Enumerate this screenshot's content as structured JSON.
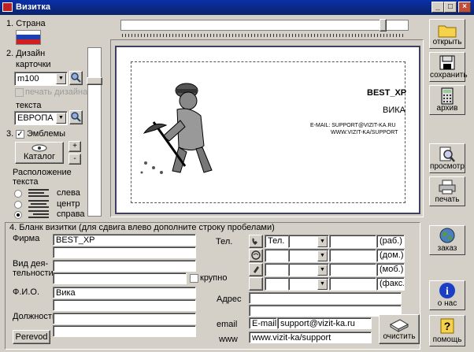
{
  "window": {
    "title": "Визитка"
  },
  "left": {
    "country_label": "1. Страна",
    "design_label_1": "2. Дизайн",
    "design_label_2": "карточки",
    "design_value": "m100",
    "design_check_label": "печать дизайна",
    "text_label": "текста",
    "text_value": "ЕВРОПА",
    "emblems_label": "3.",
    "emblems_check_label": "Эмблемы",
    "catalog_button": "Каталог",
    "plus": "+",
    "minus": "-",
    "placement_label_1": "Расположение",
    "placement_label_2": "текста",
    "placement_options": [
      "слева",
      "центр",
      "справа"
    ],
    "placement_selected": 2
  },
  "card": {
    "company": "BEST_XP",
    "name": "ВИКА",
    "email_line": "E-MAIL: SUPPORT@VIZIT-KA.RU",
    "www_line": "WWW.VIZIT-KA/SUPPORT"
  },
  "form": {
    "heading": "4. Бланк визитки (для сдвига влево дополните строку пробелами)",
    "firm_label": "Фирма",
    "firm_value": "BEST_XP",
    "activity_label_1": "Вид дея-",
    "activity_label_2": "тельности",
    "bold_label": "крупно",
    "fio_label": "Ф.И.О.",
    "fio_value": "Вика",
    "position_label": "Должность",
    "perevod_button": "Perevod",
    "phone_label": "Тел.",
    "phone_rows": [
      {
        "prefix": "Тел.",
        "suffix": "(раб.)"
      },
      {
        "prefix": "",
        "suffix": "(дом.)"
      },
      {
        "prefix": "",
        "suffix": "(моб.)"
      },
      {
        "prefix": "",
        "suffix": "(факс.)"
      }
    ],
    "address_label": "Адрес",
    "email_label": "email",
    "email_prefix": "E-mail:",
    "email_value": "support@vizit-ka.ru",
    "www_label": "www",
    "www_value": "www.vizit-ka/support",
    "clear_button": "очистить"
  },
  "sidebar": {
    "open": "открыть",
    "save": "сохранить",
    "archive": "архив",
    "preview": "просмотр",
    "print": "печать",
    "order": "заказ",
    "about": "о нас",
    "help": "помощь"
  }
}
